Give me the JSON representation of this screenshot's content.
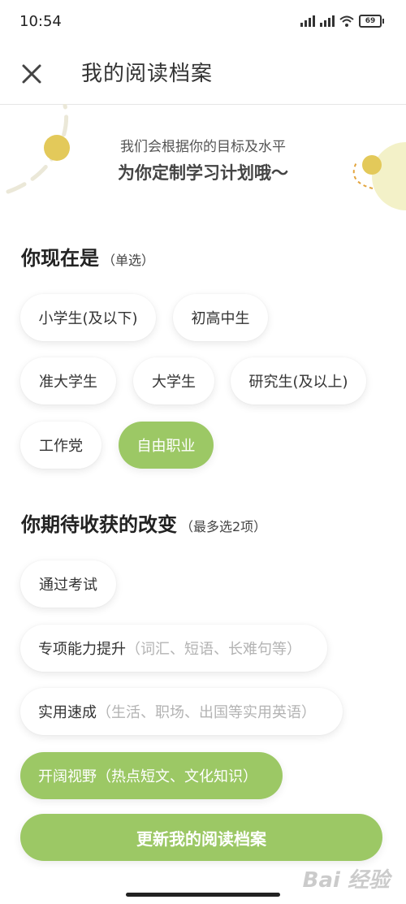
{
  "status_bar": {
    "time": "10:54",
    "battery": "69"
  },
  "header": {
    "title": "我的阅读档案",
    "close_icon": "close-icon"
  },
  "intro": {
    "line1": "我们会根据你的目标及水平",
    "line2": "为你定制学习计划哦～"
  },
  "identity_section": {
    "title": "你现在是",
    "note": "（单选）",
    "options": [
      {
        "label": "小学生(及以下)",
        "selected": false
      },
      {
        "label": "初高中生",
        "selected": false
      },
      {
        "label": "准大学生",
        "selected": false
      },
      {
        "label": "大学生",
        "selected": false
      },
      {
        "label": "研究生(及以上)",
        "selected": false
      },
      {
        "label": "工作党",
        "selected": false
      },
      {
        "label": "自由职业",
        "selected": true
      }
    ]
  },
  "goals_section": {
    "title": "你期待收获的改变",
    "note": "（最多选2项）",
    "options": [
      {
        "label": "通过考试",
        "hint": "",
        "selected": false
      },
      {
        "label": "专项能力提升",
        "hint": "（词汇、短语、长难句等）",
        "selected": false
      },
      {
        "label": "实用速成",
        "hint": "（生活、职场、出国等实用英语）",
        "selected": false
      },
      {
        "label": "开阔视野",
        "hint": "（热点短文、文化知识）",
        "selected": true
      }
    ]
  },
  "submit_label": "更新我的阅读档案",
  "watermark": "Bai 经验",
  "colors": {
    "accent": "#9cc865",
    "deco_yellow": "#e3c95a",
    "deco_light": "#f3f1c8"
  }
}
